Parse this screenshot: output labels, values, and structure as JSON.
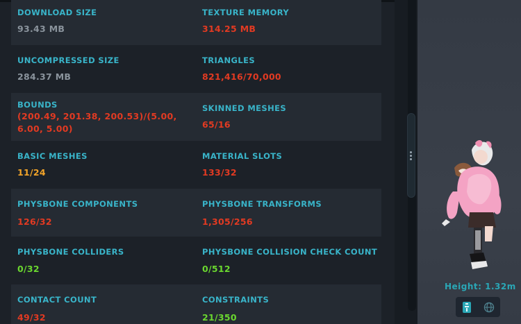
{
  "stats": [
    {
      "left": {
        "label": "DOWNLOAD SIZE",
        "value": "93.43 MB",
        "status": "gray"
      },
      "right": {
        "label": "TEXTURE MEMORY",
        "value": "314.25 MB",
        "status": "red"
      }
    },
    {
      "left": {
        "label": "UNCOMPRESSED SIZE",
        "value": "284.37 MB",
        "status": "gray"
      },
      "right": {
        "label": "TRIANGLES",
        "value": "821,416/70,000",
        "status": "red"
      }
    },
    {
      "left": {
        "label": "BOUNDS",
        "value_line1": "(200.49, 201.38, 200.53)/(5.00,",
        "value_line2": "6.00, 5.00)",
        "status": "red"
      },
      "right": {
        "label": "SKINNED MESHES",
        "value": "65/16",
        "status": "red"
      }
    },
    {
      "left": {
        "label": "BASIC MESHES",
        "value": "11/24",
        "status": "orange"
      },
      "right": {
        "label": "MATERIAL SLOTS",
        "value": "133/32",
        "status": "red"
      }
    },
    {
      "left": {
        "label": "PHYSBONE COMPONENTS",
        "value": "126/32",
        "status": "red"
      },
      "right": {
        "label": "PHYSBONE TRANSFORMS",
        "value": "1,305/256",
        "status": "red"
      }
    },
    {
      "left": {
        "label": "PHYSBONE COLLIDERS",
        "value": "0/32",
        "status": "green"
      },
      "right": {
        "label": "PHYSBONE COLLISION CHECK COUNT",
        "value": "0/512",
        "status": "green"
      }
    },
    {
      "left": {
        "label": "CONTACT COUNT",
        "value": "49/32",
        "status": "red"
      },
      "right": {
        "label": "CONSTRAINTS",
        "value": "21/350",
        "status": "green"
      }
    }
  ],
  "preview": {
    "height_text": "Height: 1.32m",
    "mode_buttons": [
      "rig-icon",
      "globe-icon"
    ]
  },
  "colors": {
    "label": "#39b4c9",
    "gray": "#8a939c",
    "red": "#e23a22",
    "orange": "#f2a429",
    "green": "#6ad72f",
    "accent": "#2aa7b6"
  }
}
